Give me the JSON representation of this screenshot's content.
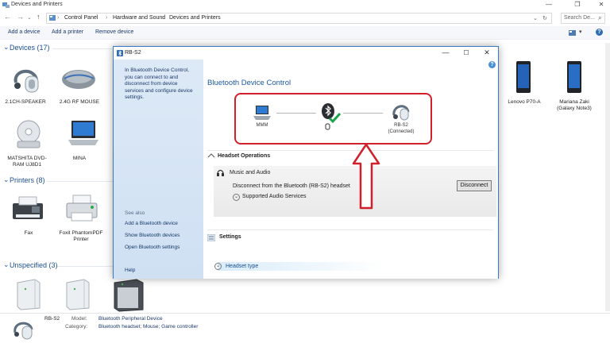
{
  "window": {
    "title": "Devices and Printers",
    "minimize": "—",
    "maximize": "❐",
    "close": "✕"
  },
  "address": {
    "crumbs": [
      "Control Panel",
      "Hardware and Sound",
      "Devices and Printers"
    ],
    "search_placeholder": "Search De..."
  },
  "commands": {
    "add_device": "Add a device",
    "add_printer": "Add a printer",
    "remove_device": "Remove device"
  },
  "groups": {
    "devices": "Devices (17)",
    "printers": "Printers (8)",
    "unspecified": "Unspecified (3)"
  },
  "devices": [
    {
      "label": "2.1CH-SPEAKER"
    },
    {
      "label": "2.4G RF MOUSE"
    },
    {
      "label": "MATSHITA DVD-RAM UJ8D1"
    },
    {
      "label": "MINA"
    },
    {
      "label": "Lenovo P70-A"
    },
    {
      "label": "Mariana Zaki (Galaxy Note3)"
    }
  ],
  "printers": [
    {
      "label": "Fax"
    },
    {
      "label": "Foxit PhantomPDF Printer"
    }
  ],
  "dialog": {
    "title": "RB-S2",
    "description": "In Bluetooth Device Control, you can connect to and disconnect from device services and configure device settings.",
    "see_also": "See also",
    "links": [
      "Add a Bluetooth device",
      "Show Bluetooth devices",
      "Open Bluetooth settings"
    ],
    "help": "Help",
    "heading": "Bluetooth Device Control",
    "help_icon": "?",
    "node_pc": "MMM",
    "node_device": "RB-S2",
    "node_device_status": "(Connected)",
    "headset_operations": "Headset Operations",
    "music_audio": "Music and Audio",
    "disconnect_text": "Disconnect from the Bluetooth (RB-S2) headset",
    "disconnect_button": "Disconnect",
    "supported_services": "Supported Audio Services",
    "settings": "Settings",
    "headset_type": "Headset type"
  },
  "details": {
    "device_name": "RB-S2",
    "model_key": "Model:",
    "model_value": "Bluetooth Peripheral Device",
    "category_key": "Category:",
    "category_value": "Bluetooth headset; Mouse; Game controller"
  },
  "colors": {
    "accent": "#1b5aa5",
    "highlight_red": "#d1202a",
    "bluetooth_check": "#1aa34a"
  }
}
